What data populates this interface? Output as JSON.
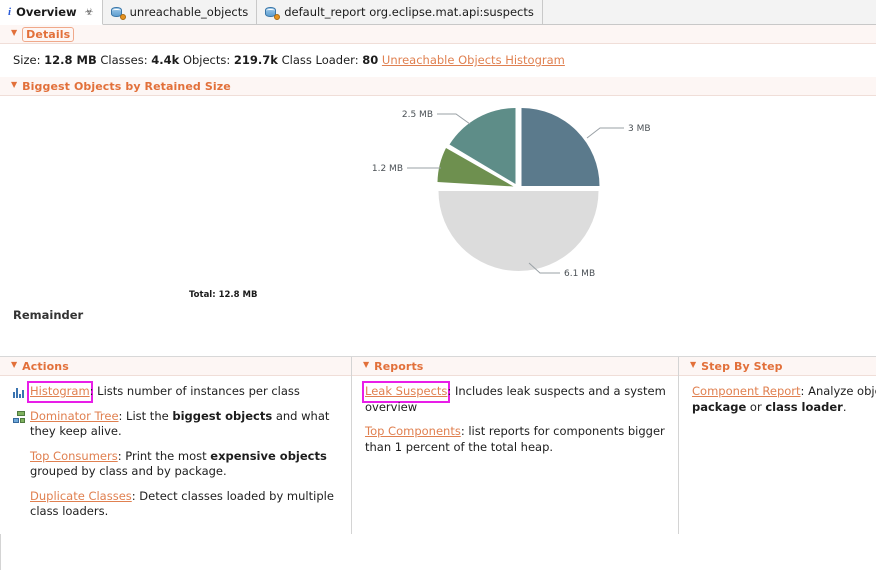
{
  "tabs": [
    {
      "label": "Overview",
      "icon": "info-icon",
      "active": true,
      "closeable": true
    },
    {
      "label": "unreachable_objects",
      "icon": "heap-dump-icon",
      "active": false,
      "closeable": false
    },
    {
      "label": "default_report org.eclipse.mat.api:suspects",
      "icon": "heap-dump-icon",
      "active": false,
      "closeable": false
    }
  ],
  "details": {
    "title": "Details",
    "size_label": "Size:",
    "size_value": "12.8 MB",
    "classes_label": "Classes:",
    "classes_value": "4.4k",
    "objects_label": "Objects:",
    "objects_value": "219.7k",
    "classloader_label": "Class Loader:",
    "classloader_value": "80",
    "unreachable_link": "Unreachable Objects Histogram"
  },
  "biggest_objects": {
    "title": "Biggest Objects by Retained Size",
    "total_label": "Total: 12.8 MB",
    "remainder_label": "Remainder"
  },
  "chart_data": {
    "type": "pie",
    "title": "Biggest Objects by Retained Size",
    "total": "12.8 MB",
    "unit": "MB",
    "labels": [
      "3 MB",
      "2.5 MB",
      "1.2 MB",
      "6.1 MB"
    ],
    "values": [
      3.0,
      2.5,
      1.2,
      6.1
    ],
    "colors": [
      "#5b7a8c",
      "#5e8d88",
      "#6e904f",
      "#dcdcdc"
    ],
    "legend": [
      "Remainder"
    ],
    "legend_position": "bottom-left"
  },
  "actions": {
    "title": "Actions",
    "items": [
      {
        "icon": "histogram-icon",
        "link": "Histogram",
        "highlighted": true,
        "desc_prefix": ": Lists number of instances per class",
        "desc_parts": [
          {
            "text": ": Lists number of instances per class",
            "bold": false
          }
        ]
      },
      {
        "icon": "dominator-tree-icon",
        "link": "Dominator Tree",
        "highlighted": false,
        "desc_parts": [
          {
            "text": ": List the ",
            "bold": false
          },
          {
            "text": "biggest objects",
            "bold": true
          },
          {
            "text": " and what they keep alive.",
            "bold": false
          }
        ]
      },
      {
        "icon": "none",
        "link": "Top Consumers",
        "highlighted": false,
        "desc_parts": [
          {
            "text": ": Print the most ",
            "bold": false
          },
          {
            "text": "expensive objects",
            "bold": true
          },
          {
            "text": " grouped by class and by package.",
            "bold": false
          }
        ]
      },
      {
        "icon": "none",
        "link": "Duplicate Classes",
        "highlighted": false,
        "desc_parts": [
          {
            "text": ": Detect classes loaded by multiple class loaders.",
            "bold": false
          }
        ]
      }
    ]
  },
  "reports": {
    "title": "Reports",
    "items": [
      {
        "link": "Leak Suspects",
        "highlighted": true,
        "desc_parts": [
          {
            "text": ": Includes leak suspects and a system overview",
            "bold": false
          }
        ]
      },
      {
        "link": "Top Components",
        "highlighted": false,
        "desc_parts": [
          {
            "text": ": list reports for components bigger than 1 percent of the total heap.",
            "bold": false
          }
        ]
      }
    ]
  },
  "step_by_step": {
    "title": "Step By Step",
    "items": [
      {
        "link": "Component Report",
        "highlighted": false,
        "desc_parts": [
          {
            "text": ": Analyze objects ",
            "bold": false
          },
          {
            "text": "package",
            "bold": true
          },
          {
            "text": " or ",
            "bold": false
          },
          {
            "text": "class loader",
            "bold": true
          },
          {
            "text": ".",
            "bold": false
          }
        ]
      }
    ]
  }
}
